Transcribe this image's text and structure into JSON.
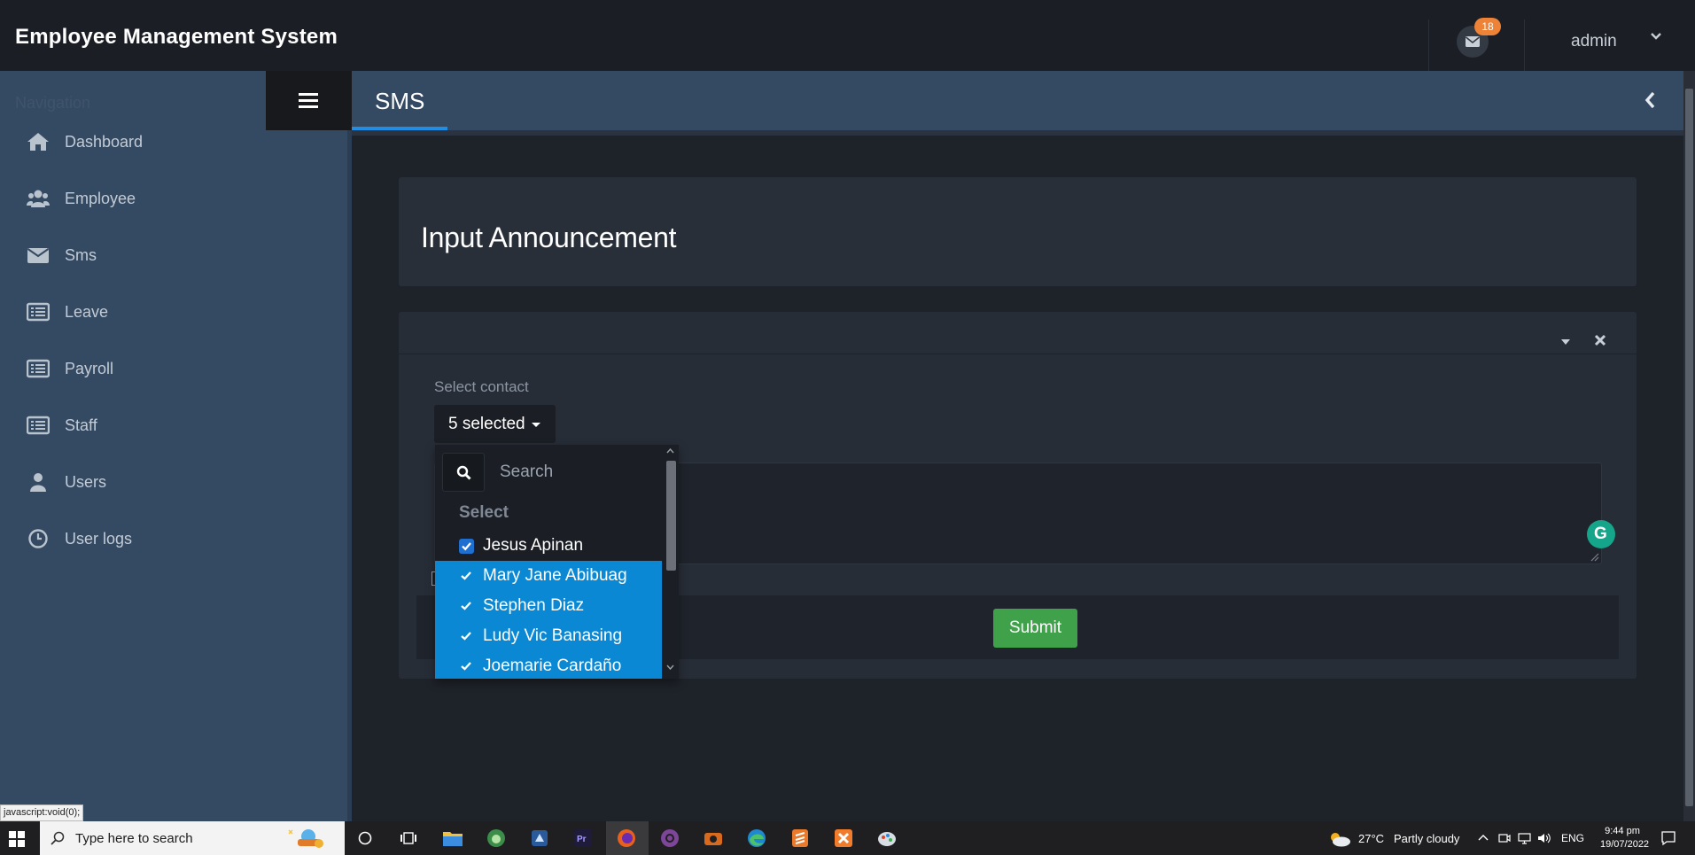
{
  "app": {
    "title": "Employee Management System"
  },
  "header": {
    "mail_count": "18",
    "user": "admin"
  },
  "sidebar": {
    "heading": "Navigation",
    "items": [
      {
        "label": "Dashboard",
        "icon": "home-icon"
      },
      {
        "label": "Employee",
        "icon": "users-icon"
      },
      {
        "label": "Sms",
        "icon": "envelope-icon"
      },
      {
        "label": "Leave",
        "icon": "list-icon"
      },
      {
        "label": "Payroll",
        "icon": "list-icon"
      },
      {
        "label": "Staff",
        "icon": "list-icon"
      },
      {
        "label": "Users",
        "icon": "user-icon"
      },
      {
        "label": "User logs",
        "icon": "clock-icon"
      }
    ]
  },
  "page": {
    "title": "SMS"
  },
  "announcement": {
    "title": "Input Announcement"
  },
  "form": {
    "contact_label": "Select contact",
    "selected_text": "5 selected",
    "submit_label": "Submit"
  },
  "dropdown": {
    "search_placeholder": "Search",
    "group_label": "Select",
    "options": [
      {
        "label": "Jesus Apinan",
        "selected": true,
        "style": "checkbox"
      },
      {
        "label": "Mary Jane Abibuag",
        "selected": true,
        "style": "highlight"
      },
      {
        "label": "Stephen Diaz",
        "selected": true,
        "style": "highlight"
      },
      {
        "label": "Ludy Vic Banasing",
        "selected": true,
        "style": "highlight"
      },
      {
        "label": "Joemarie Cardaño",
        "selected": true,
        "style": "highlight"
      }
    ]
  },
  "status_url": "javascript:void(0);",
  "taskbar": {
    "search_placeholder": "Type here to search",
    "weather_temp": "27°C",
    "weather_desc": "Partly cloudy",
    "lang": "ENG",
    "time": "9:44 pm",
    "date": "19/07/2022"
  },
  "colors": {
    "sidebar": "#344962",
    "accent_blue": "#0b88d4",
    "submit_green": "#3fa14a",
    "badge_orange": "#ee8236"
  }
}
